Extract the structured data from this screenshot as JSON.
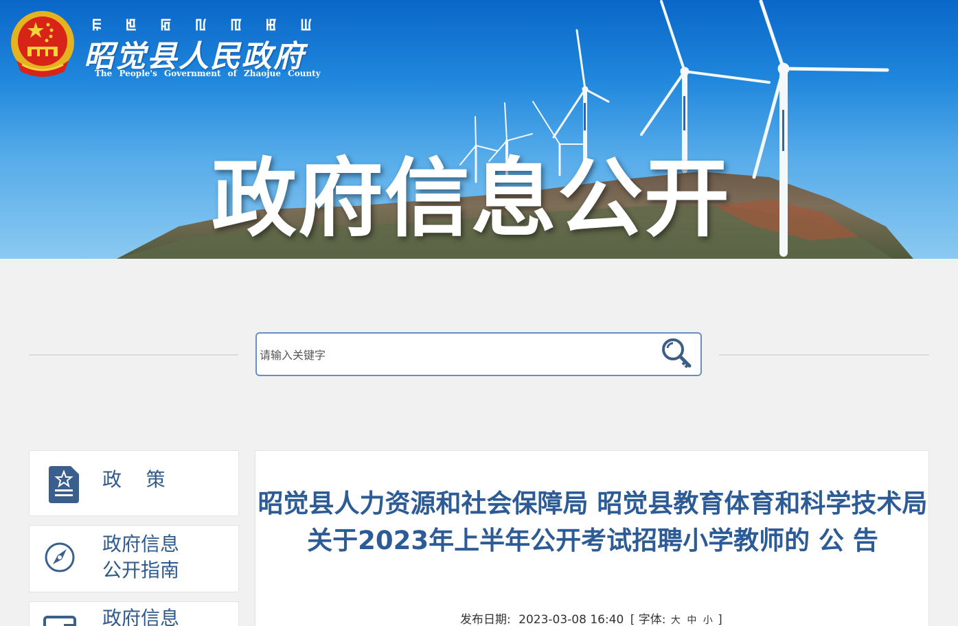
{
  "header": {
    "script_chars": [
      "ꡀ",
      "ꡁ",
      "ꡂ",
      "ꡃ",
      "ꡄ",
      "ꡅ",
      "ꡆ"
    ],
    "site_name": "昭觉县人民政府",
    "site_name_en": "The People's Government of Zhaojue County",
    "banner_title": "政府信息公开"
  },
  "search": {
    "placeholder": "请输入关键字",
    "value": ""
  },
  "sidebar": {
    "items": [
      {
        "label": "政    策",
        "icon": "document-star-icon"
      },
      {
        "label": "政府信息\n公开指南",
        "icon": "compass-icon"
      },
      {
        "label": "政府信息",
        "icon": "folder-icon"
      }
    ]
  },
  "article": {
    "title": "昭觉县人力资源和社会保障局 昭觉县教育体育和科学技术局 关于2023年上半年公开考试招聘小学教师的 公 告",
    "publish_label": "发布日期:",
    "publish_date": "2023-03-08 16:40",
    "font_label": "[ 字体:",
    "font_large": "大",
    "font_medium": "中",
    "font_small": "小",
    "bracket_close": "]"
  },
  "colors": {
    "accent_blue": "#2d5b96",
    "link_blue": "#2f5a8b",
    "search_border": "#6b8cbf"
  }
}
